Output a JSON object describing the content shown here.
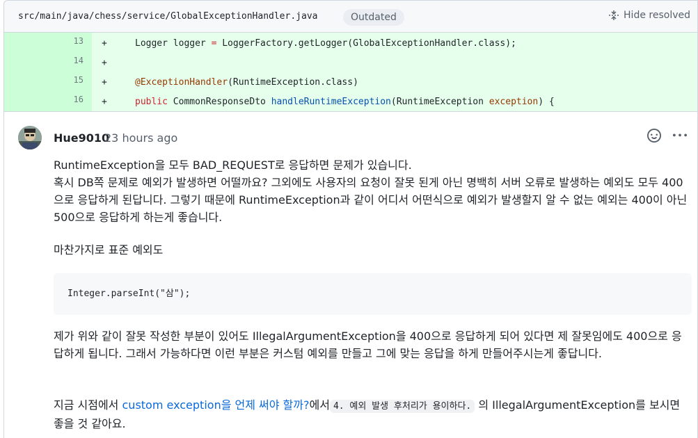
{
  "file_header": {
    "path": "src/main/java/chess/service/GlobalExceptionHandler.java",
    "badge": "Outdated",
    "hide_resolved": "Hide resolved"
  },
  "diff_lines": [
    {
      "num": "13",
      "sign": "+",
      "parts": [
        {
          "t": "Logger logger ",
          "c": ""
        },
        {
          "t": "=",
          "c": "kw"
        },
        {
          "t": " LoggerFactory.getLogger(GlobalExceptionHandler.class);",
          "c": ""
        }
      ]
    },
    {
      "num": "14",
      "sign": "+",
      "parts": []
    },
    {
      "num": "15",
      "sign": "+",
      "parts": [
        {
          "t": "@ExceptionHandler",
          "c": "ann"
        },
        {
          "t": "(RuntimeException.class)",
          "c": ""
        }
      ]
    },
    {
      "num": "16",
      "sign": "+",
      "parts": [
        {
          "t": "public",
          "c": "kw"
        },
        {
          "t": " CommonResponseDto ",
          "c": ""
        },
        {
          "t": "handleRuntimeException",
          "c": "cls"
        },
        {
          "t": "(RuntimeException ",
          "c": ""
        },
        {
          "t": "exception",
          "c": "param"
        },
        {
          "t": ") {",
          "c": ""
        }
      ]
    }
  ],
  "comment": {
    "author": "Hue9010",
    "time": "23 hours ago",
    "para1_line1": "RuntimeException을 모두 BAD_REQUEST로 응답하면 문제가 있습니다.",
    "para1_rest": "혹시 DB쪽 문제로 예외가 발생하면 어떨까요? 그외에도 사용자의 요청이 잘못 된게 아닌 명백히 서버 오류로 발생하는 예외도 모두 400으로 응답하게 된답니다. 그렇기 때문에 RuntimeException과 같이 어디서 어떤식으로 예외가 발생할지 알 수 없는 예외는 400이 아닌 500으로 응답하게 하는게 좋습니다.",
    "para2": "마찬가지로 표준 예외도",
    "code": "Integer.parseInt(\"삼\");",
    "para3": "제가 위와 같이 잘못 작성한 부분이 있어도 IllegalArgumentException을 400으로 응답하게 되어 있다면 제 잘못임에도 400으로 응답하게 됩니다. 그래서 가능하다면 이런 부분은 커스텀 예외를 만들고 그에 맞는 응답을 하게 만들어주시는게 좋답니다.",
    "para4_prefix": "지금 시점에서 ",
    "para4_link": "custom exception을 언제 써야 할까?",
    "para4_mid": "에서",
    "para4_code": "4. 예외 발생 후처리가 용이하다.",
    "para4_suffix": " 의 IllegalArgumentException를 보시면 좋을 것 같아요."
  },
  "icons": {
    "hide_resolved": "fold-icon",
    "reaction": "smiley-icon",
    "more": "kebab-horizontal-icon"
  }
}
